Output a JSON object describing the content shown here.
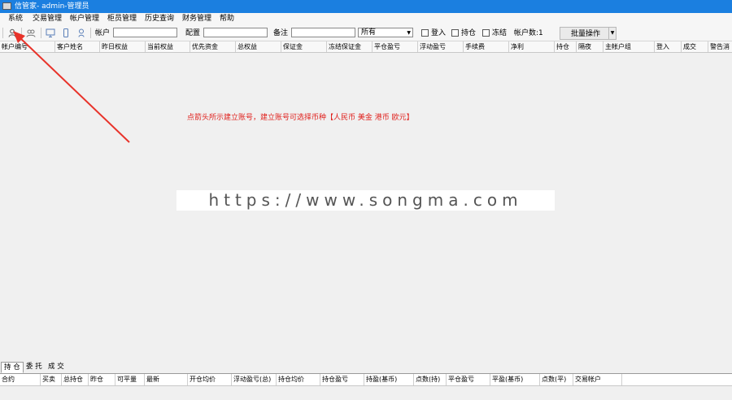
{
  "window": {
    "title": "信管家- admin-管理员"
  },
  "menu": [
    "系统",
    "交易管理",
    "帐户管理",
    "柜员管理",
    "历史查询",
    "财务管理",
    "帮助"
  ],
  "toolbar": {
    "account_label": "帐户",
    "config_label": "配置",
    "remark_label": "备注",
    "filter_selected": "所有",
    "checkbox_login": "登入",
    "checkbox_position": "持仓",
    "checkbox_freeze": "冻结",
    "account_count": "帐户数:1",
    "batch_button": "批量操作"
  },
  "grid_columns": [
    "帐户编号",
    "客户姓名",
    "昨日权益",
    "当前权益",
    "优先资金",
    "总权益",
    "保证金",
    "冻结保证金",
    "平仓盈亏",
    "浮动盈亏",
    "手续费",
    "净利",
    "持仓",
    "隔夜",
    "主帐户组",
    "登入",
    "成交",
    "警告消"
  ],
  "annotation": "点箭头所示建立账号，建立账号可选择币种【人民币 美金 港币 欧元】",
  "watermark": "https://www.songma.com",
  "tabs": [
    "持 仓",
    "委 托",
    "成 交"
  ],
  "bottom_columns": [
    "合约",
    "买卖",
    "总持仓",
    "昨仓",
    "可平量",
    "最新",
    "开仓均价",
    "浮动盈亏(总)",
    "持仓均价",
    "持仓盈亏",
    "持盈(基币)",
    "点数(持)",
    "平仓盈亏",
    "平盈(基币)",
    "点数(平)",
    "交易帐户"
  ],
  "colors": {
    "titlebar": "#1b7fe0",
    "annotation": "#e0201c"
  }
}
